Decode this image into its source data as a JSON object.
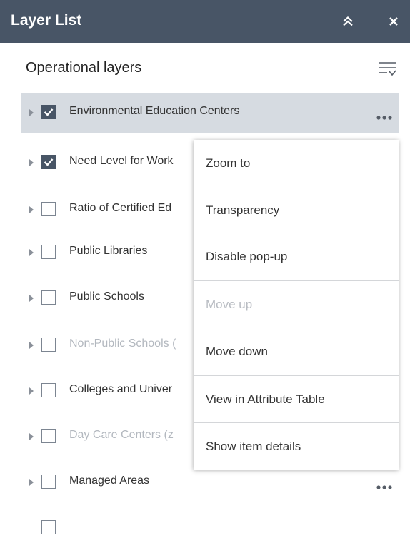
{
  "header": {
    "title": "Layer List"
  },
  "section": {
    "title": "Operational layers"
  },
  "layers": [
    {
      "label": "Environmental Education Centers",
      "checked": true,
      "dim": false
    },
    {
      "label": "Need Level for Work",
      "checked": true,
      "dim": false
    },
    {
      "label": "Ratio of Certified Ed",
      "checked": false,
      "dim": false
    },
    {
      "label": "Public Libraries",
      "checked": false,
      "dim": false
    },
    {
      "label": "Public Schools",
      "checked": false,
      "dim": false
    },
    {
      "label": "Non-Public Schools (",
      "checked": false,
      "dim": true
    },
    {
      "label": "Colleges and Univer",
      "checked": false,
      "dim": false
    },
    {
      "label": "Day Care Centers (z",
      "checked": false,
      "dim": true
    },
    {
      "label": "Managed Areas",
      "checked": false,
      "dim": false
    }
  ],
  "menu": {
    "items": [
      {
        "label": "Zoom to",
        "disabled": false
      },
      {
        "label": "Transparency",
        "disabled": false
      },
      {
        "label": "Disable pop-up",
        "disabled": false
      },
      {
        "label": "Move up",
        "disabled": true
      },
      {
        "label": "Move down",
        "disabled": false
      },
      {
        "label": "View in Attribute Table",
        "disabled": false
      },
      {
        "label": "Show item details",
        "disabled": false
      }
    ]
  },
  "colors": {
    "header_bg": "#485566",
    "selected_row_bg": "#d6dbe1",
    "checked_box": "#485566",
    "dim_text": "#b3b8bf"
  },
  "icons": {
    "collapse": "double-chevron-up-icon",
    "close": "close-icon",
    "filter": "filter-list-icon",
    "expand": "caret-right-icon",
    "more": "ellipsis-icon"
  }
}
